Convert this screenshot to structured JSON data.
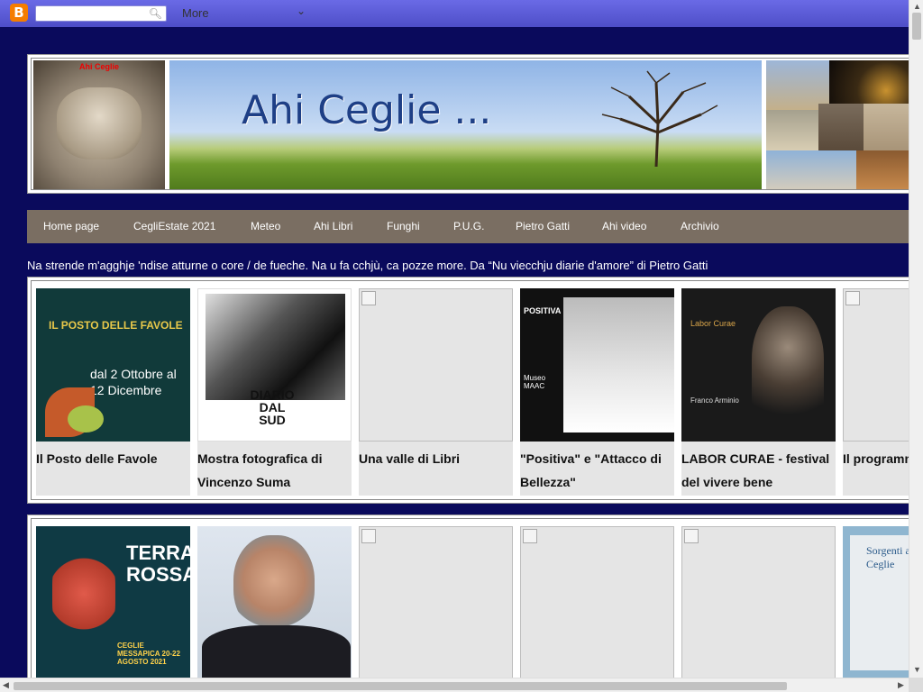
{
  "navbar": {
    "logo_letter": "B",
    "search_placeholder": "",
    "more_label": "More"
  },
  "header": {
    "title": "Ahi Ceglie ...",
    "face_caption": "Ahi Ceglie"
  },
  "menu": {
    "items": [
      {
        "label": "Home page"
      },
      {
        "label": "CegliEstate 2021"
      },
      {
        "label": "Meteo"
      },
      {
        "label": "Ahi Libri"
      },
      {
        "label": "Funghi"
      },
      {
        "label": "P.U.G."
      },
      {
        "label": "Pietro Gatti"
      },
      {
        "label": "Ahi video"
      },
      {
        "label": "Archivio"
      }
    ]
  },
  "quote": "Na strende m'agghje 'ndise atturne o core / de fueche. Na u fa cchjù, ca pozze more. Da “Nu viecchju diarie d'amore” di Pietro Gatti",
  "gallery1": {
    "cards": [
      {
        "caption": "Il Posto delle Favole",
        "thumb_text": "IL POSTO DELLE FAVOLE",
        "thumb_sub": "dal 2 Ottobre al 12 Dicembre"
      },
      {
        "caption": "Mostra fotografica di Vincenzo Suma",
        "thumb_text": "DIARIO DAL SUD"
      },
      {
        "caption": "Una valle di Libri"
      },
      {
        "caption": "\"Positiva\" e \"Attacco di Bellezza\"",
        "thumb_text": "POSITIVA",
        "thumb_sub": "Museo MAAC"
      },
      {
        "caption": "LABOR CURAE - festival del vivere bene",
        "thumb_text": "Labor Curae",
        "thumb_sub": "Franco Arminio"
      },
      {
        "caption": "Il programma \"Piazza\""
      }
    ]
  },
  "gallery2": {
    "cards": [
      {
        "thumb_text": "TERRA ROSSA",
        "thumb_sub": "CEGLIE MESSAPICA 20-22 AGOSTO 2021"
      },
      {},
      {},
      {},
      {},
      {
        "thumb_text": "Sorgenti a Ceglie"
      }
    ]
  },
  "colors": {
    "page_bg": "#0a0a5c",
    "menu_bg": "#7a6e62",
    "navbar": "#5a5ad8",
    "card_bg": "#e5e5e5"
  }
}
